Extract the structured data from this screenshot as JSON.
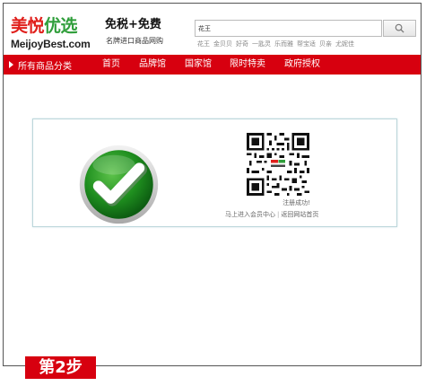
{
  "header": {
    "logo_cn_red": "美悦",
    "logo_cn_green": "优选",
    "logo_en": "MeijoyBest.com",
    "slogan": "免税+免费",
    "slogan_sub": "名牌进口商品网购"
  },
  "search": {
    "value": "花王",
    "button_icon": "search-icon",
    "hot_keywords": [
      "花王",
      "金贝贝",
      "好奇",
      "一匙灵",
      "乐而雅",
      "帮宝适",
      "贝亲",
      "尤妮佳"
    ]
  },
  "nav": {
    "all_categories": "所有商品分类",
    "items": [
      "首页",
      "品牌馆",
      "国家馆",
      "限时特卖",
      "政府授权"
    ]
  },
  "result": {
    "success_icon": "checkmark-icon",
    "qr_icon": "qr-code-icon",
    "message": "注册成功!",
    "link_member": "马上进入会员中心",
    "separator": "|",
    "link_home": "返回网站首页"
  },
  "step_label": "第2步",
  "colors": {
    "nav_red": "#d7000f",
    "logo_red": "#e0201c",
    "logo_green": "#2f9e3a",
    "check_green": "#1f8f1f"
  }
}
